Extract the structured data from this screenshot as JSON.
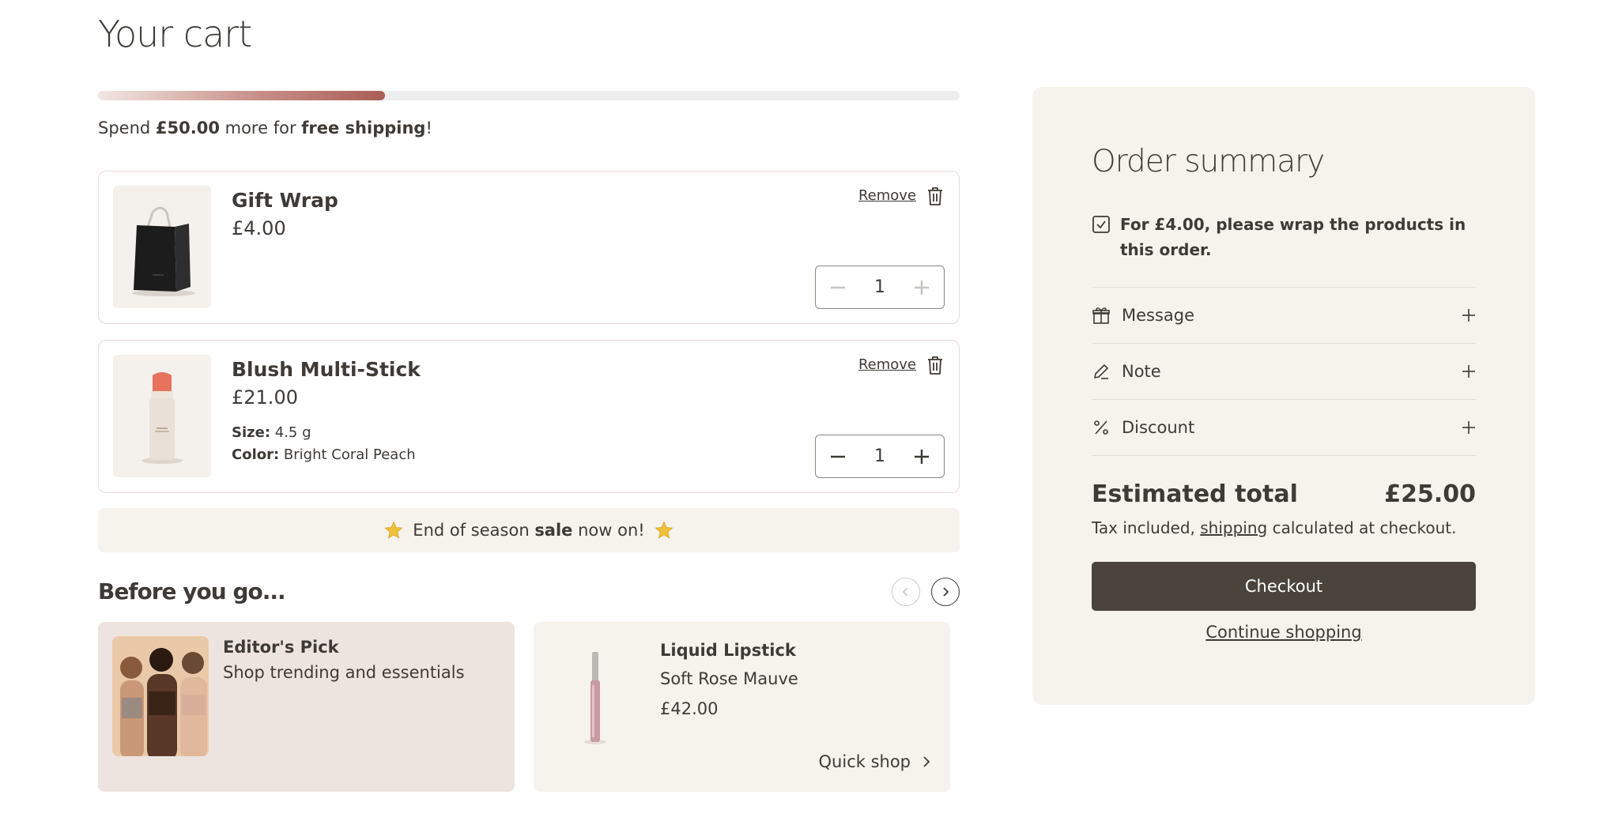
{
  "page": {
    "title": "Your cart"
  },
  "shipping": {
    "progress_fraction": 0.333,
    "prefix": "Spend ",
    "amount": "£50.00",
    "middle": " more for ",
    "goal": "free shipping",
    "suffix": "!"
  },
  "items": [
    {
      "name": "Gift Wrap",
      "price": "£4.00",
      "remove_label": "Remove",
      "quantity": "1",
      "attrs": []
    },
    {
      "name": "Blush Multi-Stick",
      "price": "£21.00",
      "remove_label": "Remove",
      "quantity": "1",
      "attrs": [
        {
          "label": "Size:",
          "value": " 4.5 g"
        },
        {
          "label": "Color:",
          "value": " Bright Coral Peach"
        }
      ]
    }
  ],
  "sale_banner": {
    "prefix": "End of season ",
    "bold": "sale",
    "suffix": " now on!"
  },
  "recommendations": {
    "heading": "Before you go...",
    "cards": [
      {
        "title": "Editor's Pick",
        "subtitle": "Shop trending and essentials"
      },
      {
        "title": "Liquid Lipstick",
        "subtitle": "Soft Rose Mauve",
        "price": "£42.00",
        "action": "Quick shop"
      }
    ]
  },
  "summary": {
    "title": "Order summary",
    "gift_wrap_text": "For £4.00, please wrap the products in this order.",
    "rows": [
      {
        "label": "Message",
        "icon": "gift-icon"
      },
      {
        "label": "Note",
        "icon": "pencil-icon"
      },
      {
        "label": "Discount",
        "icon": "percent-icon"
      }
    ],
    "estimated_label": "Estimated total",
    "estimated_value": "£25.00",
    "tax_prefix": "Tax included, ",
    "tax_link": "shipping",
    "tax_suffix": " calculated at checkout.",
    "checkout_label": "Checkout",
    "continue_label": "Continue shopping"
  },
  "colors": {
    "text": "#3e3a36",
    "progress_start": "#f2e6e2",
    "progress_end": "#a85e56",
    "summary_bg": "#f6f2ec",
    "checkout_bg": "#4a443c"
  }
}
